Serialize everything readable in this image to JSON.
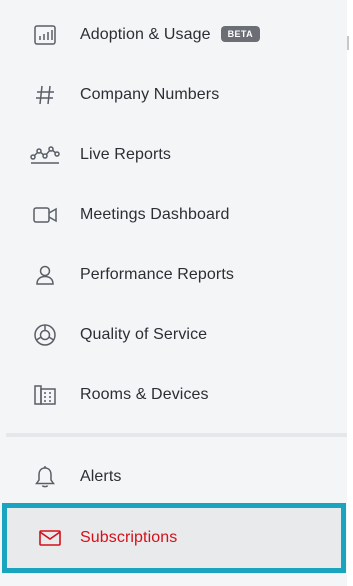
{
  "nav": {
    "items": [
      {
        "label": "Adoption & Usage",
        "badge": "BETA",
        "icon": "bar-chart-icon"
      },
      {
        "label": "Company Numbers",
        "icon": "hash-icon"
      },
      {
        "label": "Live Reports",
        "icon": "live-line-chart-icon"
      },
      {
        "label": "Meetings Dashboard",
        "icon": "video-camera-icon"
      },
      {
        "label": "Performance Reports",
        "icon": "person-icon"
      },
      {
        "label": "Quality of Service",
        "icon": "donut-chart-icon"
      },
      {
        "label": "Rooms & Devices",
        "icon": "room-device-icon"
      }
    ],
    "alerts": {
      "label": "Alerts",
      "icon": "bell-icon"
    },
    "subscriptions": {
      "label": "Subscriptions",
      "icon": "envelope-icon"
    }
  },
  "colors": {
    "active": "#d4101a",
    "highlight_border": "#19a5c0",
    "text": "#2b2f33",
    "icon": "#5a5f66",
    "badge_bg": "#6b6f75"
  }
}
